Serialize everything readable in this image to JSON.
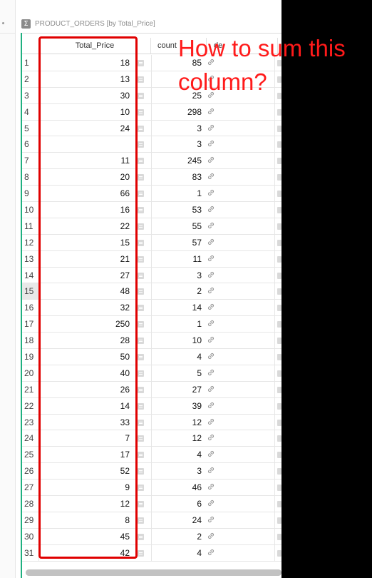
{
  "widget": {
    "title": "PRODUCT_ORDERS [by Total_Price]",
    "icon": "sigma-icon"
  },
  "columns": {
    "row_number": "",
    "total_price": "Total_Price",
    "count": "count",
    "details": "de"
  },
  "rows": [
    {
      "n": "1",
      "total_price": "18",
      "count": "85"
    },
    {
      "n": "2",
      "total_price": "13",
      "count": ""
    },
    {
      "n": "3",
      "total_price": "30",
      "count": "25"
    },
    {
      "n": "4",
      "total_price": "10",
      "count": "298"
    },
    {
      "n": "5",
      "total_price": "24",
      "count": "3"
    },
    {
      "n": "6",
      "total_price": "",
      "count": "3"
    },
    {
      "n": "7",
      "total_price": "11",
      "count": "245"
    },
    {
      "n": "8",
      "total_price": "20",
      "count": "83"
    },
    {
      "n": "9",
      "total_price": "66",
      "count": "1"
    },
    {
      "n": "10",
      "total_price": "16",
      "count": "53"
    },
    {
      "n": "11",
      "total_price": "22",
      "count": "55"
    },
    {
      "n": "12",
      "total_price": "15",
      "count": "57"
    },
    {
      "n": "13",
      "total_price": "21",
      "count": "11"
    },
    {
      "n": "14",
      "total_price": "27",
      "count": "3"
    },
    {
      "n": "15",
      "total_price": "48",
      "count": "2"
    },
    {
      "n": "16",
      "total_price": "32",
      "count": "14"
    },
    {
      "n": "17",
      "total_price": "250",
      "count": "1"
    },
    {
      "n": "18",
      "total_price": "28",
      "count": "10"
    },
    {
      "n": "19",
      "total_price": "50",
      "count": "4"
    },
    {
      "n": "20",
      "total_price": "40",
      "count": "5"
    },
    {
      "n": "21",
      "total_price": "26",
      "count": "27"
    },
    {
      "n": "22",
      "total_price": "14",
      "count": "39"
    },
    {
      "n": "23",
      "total_price": "33",
      "count": "12"
    },
    {
      "n": "24",
      "total_price": "7",
      "count": "12"
    },
    {
      "n": "25",
      "total_price": "17",
      "count": "4"
    },
    {
      "n": "26",
      "total_price": "52",
      "count": "3"
    },
    {
      "n": "27",
      "total_price": "9",
      "count": "46"
    },
    {
      "n": "28",
      "total_price": "12",
      "count": "6"
    },
    {
      "n": "29",
      "total_price": "8",
      "count": "24"
    },
    {
      "n": "30",
      "total_price": "45",
      "count": "2"
    },
    {
      "n": "31",
      "total_price": "42",
      "count": "4"
    }
  ],
  "selected_row": "15",
  "annotation": {
    "line1": "How to sum this",
    "line2": "column?",
    "color": "#ff1a1a"
  },
  "colors": {
    "widget_accent": "#1fb080",
    "highlight_box": "#e00000"
  }
}
